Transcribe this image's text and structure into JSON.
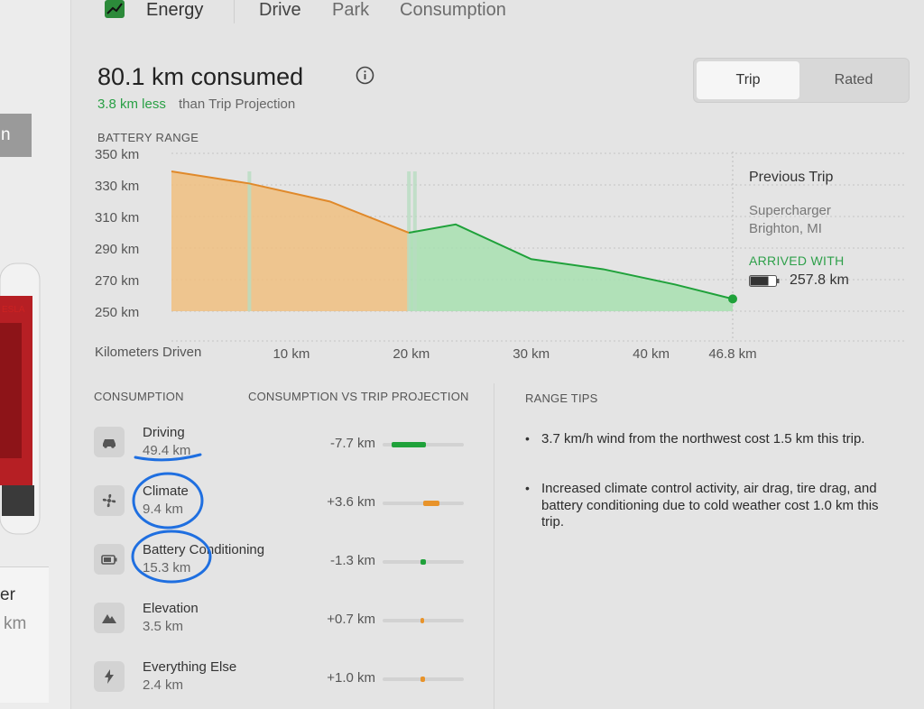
{
  "nav": {
    "tabs": [
      "Energy",
      "Drive",
      "Park",
      "Consumption"
    ]
  },
  "left_panel": {
    "button_partial": "n",
    "card_title_partial": "er",
    "card_sub_partial": "km"
  },
  "header": {
    "headline": "80.1 km consumed",
    "sub_green": "3.8 km less",
    "sub_rest": "than Trip Projection"
  },
  "toggle": {
    "trip": "Trip",
    "rated": "Rated",
    "selected": "Trip"
  },
  "chart_data": {
    "type": "area",
    "title": "BATTERY RANGE",
    "xlabel": "Kilometers Driven",
    "ylabel": "",
    "y_ticks": [
      "350 km",
      "330 km",
      "310 km",
      "290 km",
      "270 km",
      "250 km"
    ],
    "x_ticks": [
      "10 km",
      "20 km",
      "30 km",
      "40 km",
      "46.8 km"
    ],
    "ylim": [
      250,
      350
    ],
    "xlim": [
      0,
      46.8
    ],
    "grid": true,
    "series": [
      {
        "x": [
          0,
          6.5,
          13.2,
          19.8,
          23.7,
          30.0,
          36.0,
          42.0,
          46.8
        ],
        "y": [
          338.6,
          330.9,
          319.5,
          299.7,
          305.0,
          283.0,
          276.6,
          266.9,
          257.8
        ]
      }
    ],
    "colors": {
      "consumed_fill": "#f0c080",
      "consumed_line": "#e0892a",
      "remaining_fill": "#a8e0b0",
      "remaining_line": "#1fa13a"
    }
  },
  "side_info": {
    "previous_trip": "Previous Trip",
    "location_line1": "Supercharger",
    "location_line2": "Brighton, MI",
    "arrived_label": "ARRIVED WITH",
    "arrived_value": "257.8 km"
  },
  "sections": {
    "consumption": "CONSUMPTION",
    "vs_projection": "CONSUMPTION VS TRIP PROJECTION",
    "range_tips": "RANGE TIPS"
  },
  "categories": [
    {
      "name": "Driving",
      "value": "49.4 km",
      "delta": "-7.7 km",
      "delta_fraction": 0.42,
      "color": "#1fa13a",
      "icon": "car-icon"
    },
    {
      "name": "Climate",
      "value": "9.4 km",
      "delta": "+3.6 km",
      "delta_fraction": 0.2,
      "color": "#e8932a",
      "icon": "fan-icon"
    },
    {
      "name": "Battery Conditioning",
      "value": "15.3 km",
      "delta": "-1.3 km",
      "delta_fraction": 0.07,
      "color": "#1fa13a",
      "icon": "battery-icon"
    },
    {
      "name": "Elevation",
      "value": "3.5 km",
      "delta": "+0.7 km",
      "delta_fraction": 0.04,
      "color": "#e8932a",
      "icon": "mountain-icon"
    },
    {
      "name": "Everything Else",
      "value": "2.4 km",
      "delta": "+1.0 km",
      "delta_fraction": 0.055,
      "color": "#e8932a",
      "icon": "lightning-icon"
    }
  ],
  "range_tips": [
    {
      "text": "3.7 km/h wind from the northwest cost 1.5 km this trip."
    },
    {
      "text": "Increased climate control activity, air drag, tire drag, and battery conditioning due to cold weather cost 1.0 km this trip."
    }
  ]
}
